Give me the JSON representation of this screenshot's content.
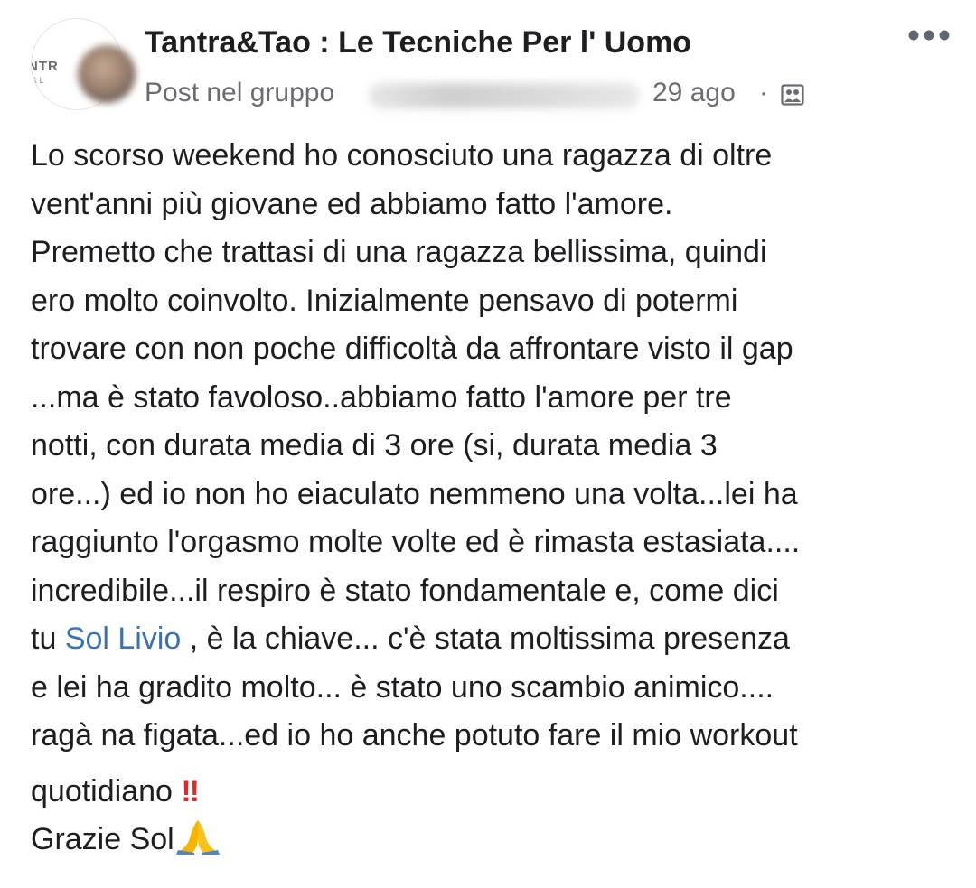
{
  "post": {
    "group_name": "Tantra&Tao : Le Tecniche Per l' Uomo",
    "group_logo_text": "NTR",
    "group_logo_sub": "& L",
    "post_in_label": "Post nel gruppo",
    "date": "29 ago",
    "separator": "·",
    "privacy_icon": "group-privacy-icon",
    "more_icon": "more-options-icon",
    "body": {
      "l1": "Lo scorso weekend ho conosciuto una ragazza di oltre",
      "l2": "vent'anni più giovane ed abbiamo fatto l'amore.",
      "l3": "Premetto che trattasi di una ragazza bellissima, quindi",
      "l4": "ero molto coinvolto. Inizialmente pensavo di potermi",
      "l5": "trovare con non poche difficoltà da affrontare visto il gap",
      "l6": "...ma è stato favoloso..abbiamo fatto l'amore per tre",
      "l7": "notti, con durata media di 3 ore (si, durata media 3",
      "l8": "ore...) ed io non ho eiaculato nemmeno una volta...lei ha",
      "l9": "raggiunto l'orgasmo molte volte ed è rimasta estasiata....",
      "l10": "incredibile...il respiro è stato fondamentale e, come dici",
      "l11_pre": "tu ",
      "l11_mention": "Sol Livio",
      "l11_post": " , è la chiave... c'è stata moltissima presenza",
      "l12": "e lei ha gradito molto... è stato uno scambio animico....",
      "l13": "ragà na figata...ed io ho anche potuto fare il mio workout",
      "l14": "quotidiano ",
      "l14_emoji": "‼",
      "l15": "Grazie Sol",
      "l15_emoji_icon": "folded-hands-icon"
    }
  },
  "colors": {
    "text": "#1c1e21",
    "secondary": "#6a6c70",
    "mention": "#3b6fb6",
    "emoji_red": "#e0272a",
    "emoji_yellow": "#f5b400"
  }
}
